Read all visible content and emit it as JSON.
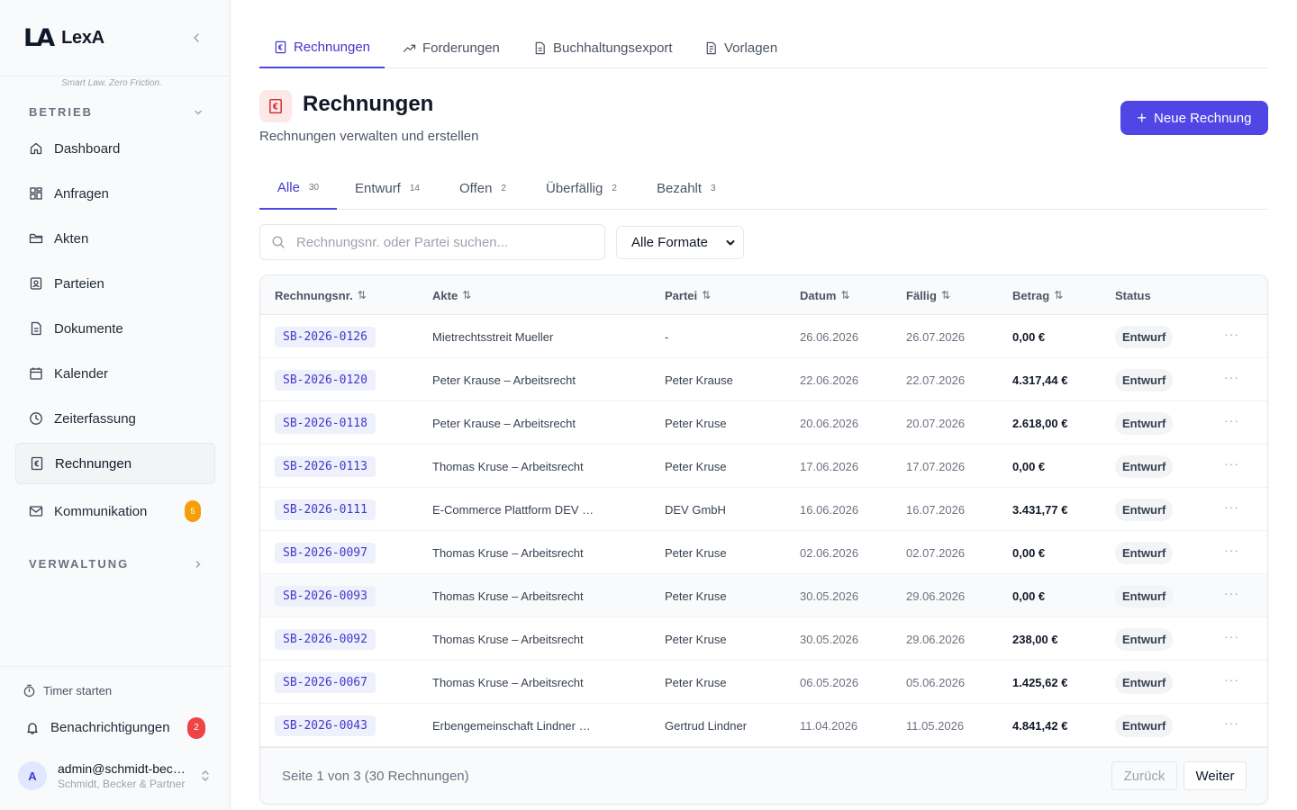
{
  "brand": {
    "logo": "LA",
    "name": "LexA",
    "tagline": "Smart Law. Zero Friction."
  },
  "sidebar": {
    "section_betrieb": "BETRIEB",
    "items": [
      {
        "label": "Dashboard",
        "icon": "home-icon"
      },
      {
        "label": "Anfragen",
        "icon": "grid-icon"
      },
      {
        "label": "Akten",
        "icon": "folder-icon"
      },
      {
        "label": "Parteien",
        "icon": "contact-icon"
      },
      {
        "label": "Dokumente",
        "icon": "document-icon"
      },
      {
        "label": "Kalender",
        "icon": "calendar-icon"
      },
      {
        "label": "Zeiterfassung",
        "icon": "clock-icon"
      },
      {
        "label": "Rechnungen",
        "icon": "invoice-icon",
        "active": true
      },
      {
        "label": "Kommunikation",
        "icon": "mail-icon",
        "badge": "5"
      }
    ],
    "section_verwaltung": "VERWALTUNG",
    "timer_label": "Timer starten",
    "notifications_label": "Benachrichtigungen",
    "notifications_badge": "2",
    "user": {
      "initial": "A",
      "email": "admin@schmidt-becker.de",
      "org": "Schmidt, Becker & Partner"
    }
  },
  "top_tabs": [
    {
      "label": "Rechnungen",
      "active": true
    },
    {
      "label": "Forderungen"
    },
    {
      "label": "Buchhaltungsexport"
    },
    {
      "label": "Vorlagen"
    }
  ],
  "header": {
    "title": "Rechnungen",
    "subtitle": "Rechnungen verwalten und erstellen",
    "new_button": "Neue Rechnung",
    "new_button_plus": "+"
  },
  "filter_tabs": [
    {
      "label": "Alle",
      "count": "30",
      "active": true
    },
    {
      "label": "Entwurf",
      "count": "14"
    },
    {
      "label": "Offen",
      "count": "2"
    },
    {
      "label": "Überfällig",
      "count": "2"
    },
    {
      "label": "Bezahlt",
      "count": "3"
    }
  ],
  "search": {
    "placeholder": "Rechnungsnr. oder Partei suchen...",
    "value": ""
  },
  "format_select": {
    "value": "Alle Formate"
  },
  "table": {
    "columns": [
      {
        "label": "Rechnungsnr.",
        "sortable": true
      },
      {
        "label": "Akte",
        "sortable": true
      },
      {
        "label": "Partei",
        "sortable": true
      },
      {
        "label": "Datum",
        "sortable": true
      },
      {
        "label": "Fällig",
        "sortable": true
      },
      {
        "label": "Betrag",
        "sortable": true
      },
      {
        "label": "Status",
        "sortable": false
      }
    ],
    "sort_glyph": "⇅",
    "more_glyph": "···",
    "rows": [
      {
        "nr": "SB-2026-0126",
        "akte": "Mietrechtsstreit Mueller",
        "partei": "-",
        "datum": "26.06.2026",
        "faellig": "26.07.2026",
        "betrag": "0,00 €",
        "status": "Entwurf"
      },
      {
        "nr": "SB-2026-0120",
        "akte": "Peter Krause – Arbeitsrecht",
        "partei": "Peter Krause",
        "datum": "22.06.2026",
        "faellig": "22.07.2026",
        "betrag": "4.317,44 €",
        "status": "Entwurf"
      },
      {
        "nr": "SB-2026-0118",
        "akte": "Peter Krause – Arbeitsrecht",
        "partei": "Peter Kruse",
        "datum": "20.06.2026",
        "faellig": "20.07.2026",
        "betrag": "2.618,00 €",
        "status": "Entwurf"
      },
      {
        "nr": "SB-2026-0113",
        "akte": "Thomas Kruse – Arbeitsrecht",
        "partei": "Peter Kruse",
        "datum": "17.06.2026",
        "faellig": "17.07.2026",
        "betrag": "0,00 €",
        "status": "Entwurf"
      },
      {
        "nr": "SB-2026-0111",
        "akte": "E-Commerce Plattform DEV …",
        "partei": "DEV GmbH",
        "datum": "16.06.2026",
        "faellig": "16.07.2026",
        "betrag": "3.431,77 €",
        "status": "Entwurf"
      },
      {
        "nr": "SB-2026-0097",
        "akte": "Thomas Kruse – Arbeitsrecht",
        "partei": "Peter Kruse",
        "datum": "02.06.2026",
        "faellig": "02.07.2026",
        "betrag": "0,00 €",
        "status": "Entwurf"
      },
      {
        "nr": "SB-2026-0093",
        "akte": "Thomas Kruse – Arbeitsrecht",
        "partei": "Peter Kruse",
        "datum": "30.05.2026",
        "faellig": "29.06.2026",
        "betrag": "0,00 €",
        "status": "Entwurf"
      },
      {
        "nr": "SB-2026-0092",
        "akte": "Thomas Kruse – Arbeitsrecht",
        "partei": "Peter Kruse",
        "datum": "30.05.2026",
        "faellig": "29.06.2026",
        "betrag": "238,00 €",
        "status": "Entwurf"
      },
      {
        "nr": "SB-2026-0067",
        "akte": "Thomas Kruse – Arbeitsrecht",
        "partei": "Peter Kruse",
        "datum": "06.05.2026",
        "faellig": "05.06.2026",
        "betrag": "1.425,62 €",
        "status": "Entwurf"
      },
      {
        "nr": "SB-2026-0043",
        "akte": "Erbengemeinschaft Lindner …",
        "partei": "Gertrud Lindner",
        "datum": "11.04.2026",
        "faellig": "11.05.2026",
        "betrag": "4.841,42 €",
        "status": "Entwurf"
      }
    ]
  },
  "pagination": {
    "info": "Seite 1 von 3 (30 Rechnungen)",
    "prev": "Zurück",
    "next": "Weiter"
  },
  "colors": {
    "accent": "#4f46e5",
    "accent_text": "#4338ca",
    "badge_orange": "#f59e0b",
    "badge_red": "#ef4444"
  }
}
